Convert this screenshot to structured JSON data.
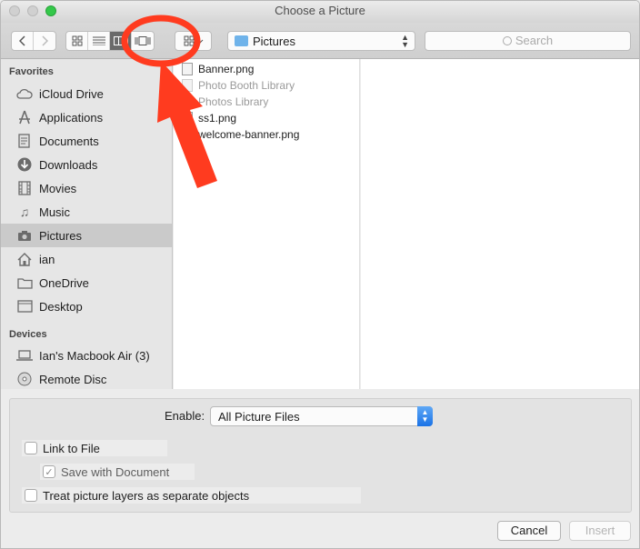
{
  "window": {
    "title": "Choose a Picture"
  },
  "toolbar": {
    "back_icon": "chevron-left-icon",
    "forward_icon": "chevron-right-icon",
    "view_modes": [
      "icon-view",
      "list-view",
      "column-view",
      "cover-flow-view"
    ],
    "active_view": "column-view",
    "location": "Pictures",
    "search_placeholder": "Search"
  },
  "sidebar": {
    "favorites_title": "Favorites",
    "favorites": [
      {
        "label": "iCloud Drive",
        "icon": "cloud-icon"
      },
      {
        "label": "Applications",
        "icon": "applications-icon"
      },
      {
        "label": "Documents",
        "icon": "document-icon"
      },
      {
        "label": "Downloads",
        "icon": "download-icon"
      },
      {
        "label": "Movies",
        "icon": "film-icon"
      },
      {
        "label": "Music",
        "icon": "music-icon"
      },
      {
        "label": "Pictures",
        "icon": "camera-icon",
        "selected": true
      },
      {
        "label": "ian",
        "icon": "home-icon"
      },
      {
        "label": "OneDrive",
        "icon": "folder-icon"
      },
      {
        "label": "Desktop",
        "icon": "desktop-icon"
      }
    ],
    "devices_title": "Devices",
    "devices": [
      {
        "label": "Ian's Macbook Air (3)",
        "icon": "laptop-icon"
      },
      {
        "label": "Remote Disc",
        "icon": "disc-icon"
      }
    ]
  },
  "files": [
    {
      "name": "Banner.png",
      "dim": false
    },
    {
      "name": "Photo Booth Library",
      "dim": true
    },
    {
      "name": "Photos Library",
      "dim": true
    },
    {
      "name": "ss1.png",
      "dim": false
    },
    {
      "name": "welcome-banner.png",
      "dim": false
    }
  ],
  "options": {
    "enable_label": "Enable:",
    "enable_value": "All Picture Files",
    "link_to_file": "Link to File",
    "save_with_document": "Save with Document",
    "treat_layers": "Treat picture layers as separate objects"
  },
  "buttons": {
    "cancel": "Cancel",
    "insert": "Insert"
  },
  "colors": {
    "accent": "#1a72e6",
    "annotation": "#ff3b1f"
  }
}
